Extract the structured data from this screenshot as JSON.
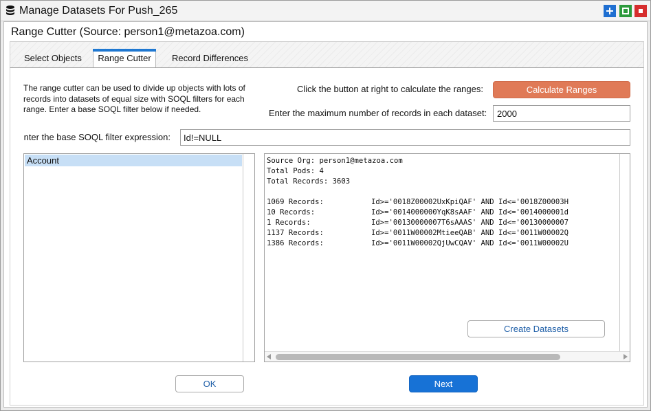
{
  "window": {
    "title": "Manage Datasets For Push_265",
    "icon": "database-icon",
    "buttons": {
      "add": "plus-icon",
      "maximize": "square-icon",
      "close": "stop-icon"
    },
    "colors": {
      "add": "#1f6fd1",
      "maximize": "#2c9a3c",
      "close": "#d62d2d"
    }
  },
  "panel": {
    "title": "Range Cutter (Source: person1@metazoa.com)"
  },
  "tabs": [
    {
      "label": "Select Objects",
      "active": false
    },
    {
      "label": "Range Cutter",
      "active": true
    },
    {
      "label": "Record Differences",
      "active": false
    }
  ],
  "range_cutter": {
    "description": "The range cutter can be used to divide up objects with lots of records into datasets of equal size with SOQL filters for each range. Enter a base SOQL filter below if needed.",
    "calculate_label": "Click the button at right to calculate the ranges:",
    "calculate_button": "Calculate Ranges",
    "max_records_label": "Enter the maximum number of records in each dataset:",
    "max_records_value": "2000",
    "soql_label": "Enter the base SOQL filter expression:",
    "soql_value": "Id!=NULL",
    "objects": [
      {
        "label": "Account",
        "selected": true
      }
    ],
    "output": {
      "lines": [
        "Source Org: person1@metazoa.com",
        "Total Pods: 4",
        "Total Records: 3603"
      ],
      "rows": [
        {
          "count": "1069 Records:",
          "filter": "Id>='0018Z00002UxKpiQAF' AND Id<='0018Z00003H"
        },
        {
          "count": "10 Records:",
          "filter": "Id>='0014000000YqK8sAAF' AND Id<='0014000001d"
        },
        {
          "count": "1 Records:",
          "filter": "Id>='00130000007T6sAAAS' AND Id<='00130000007"
        },
        {
          "count": "1137 Records:",
          "filter": "Id>='0011W00002MtieeQAB' AND Id<='0011W00002Q"
        },
        {
          "count": "1386 Records:",
          "filter": "Id>='0011W00002QjUwCQAV' AND Id<='0011W00002U"
        }
      ]
    },
    "create_button": "Create Datasets",
    "accent_color": "#e07a57"
  },
  "footer": {
    "ok": "OK",
    "next": "Next",
    "next_color": "#1772d6"
  }
}
